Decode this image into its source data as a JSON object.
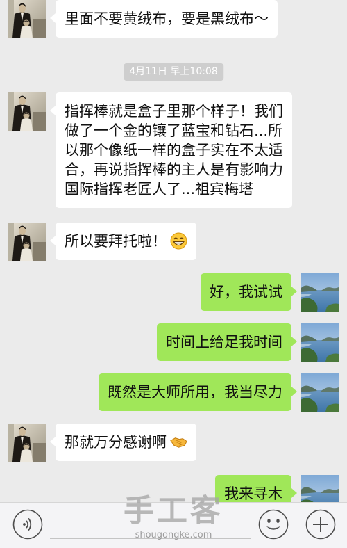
{
  "colors": {
    "background": "#ebebeb",
    "bubble_incoming": "#ffffff",
    "bubble_outgoing": "#a0e759",
    "timestamp_bg": "#cecece"
  },
  "timestamp": "4月11日 早上10:08",
  "messages": [
    {
      "outgoing": false,
      "lines": [
        "里面不要黄绒布，要是黑绒布～"
      ]
    },
    {
      "outgoing": false,
      "lines": [
        "指挥棒就是盒子里那个样子！我们",
        "做了一个金的镶了蓝宝和钻石...所",
        "以那个像纸一样的盒子实在不太适",
        "合，再说指挥棒的主人是有影响力",
        "国际指挥老匠人了...祖宾梅塔"
      ]
    },
    {
      "outgoing": false,
      "lines": [
        "所以要拜托啦！"
      ],
      "emoji": "grin-emoji-icon"
    },
    {
      "outgoing": true,
      "lines": [
        "好，我试试"
      ]
    },
    {
      "outgoing": true,
      "lines": [
        "时间上给足我时间"
      ]
    },
    {
      "outgoing": true,
      "lines": [
        "既然是大师所用，我当尽力"
      ]
    },
    {
      "outgoing": false,
      "lines": [
        "那就万分感谢啊"
      ],
      "emoji": "handshake-emoji-icon"
    },
    {
      "outgoing": true,
      "lines": [
        "我来寻木"
      ]
    }
  ],
  "input_bar": {
    "voice_icon": "voice-icon",
    "emoji_icon": "smiley-icon",
    "more_icon": "plus-icon"
  },
  "watermark": {
    "main": "手工客",
    "sub": "shougongke.com"
  }
}
